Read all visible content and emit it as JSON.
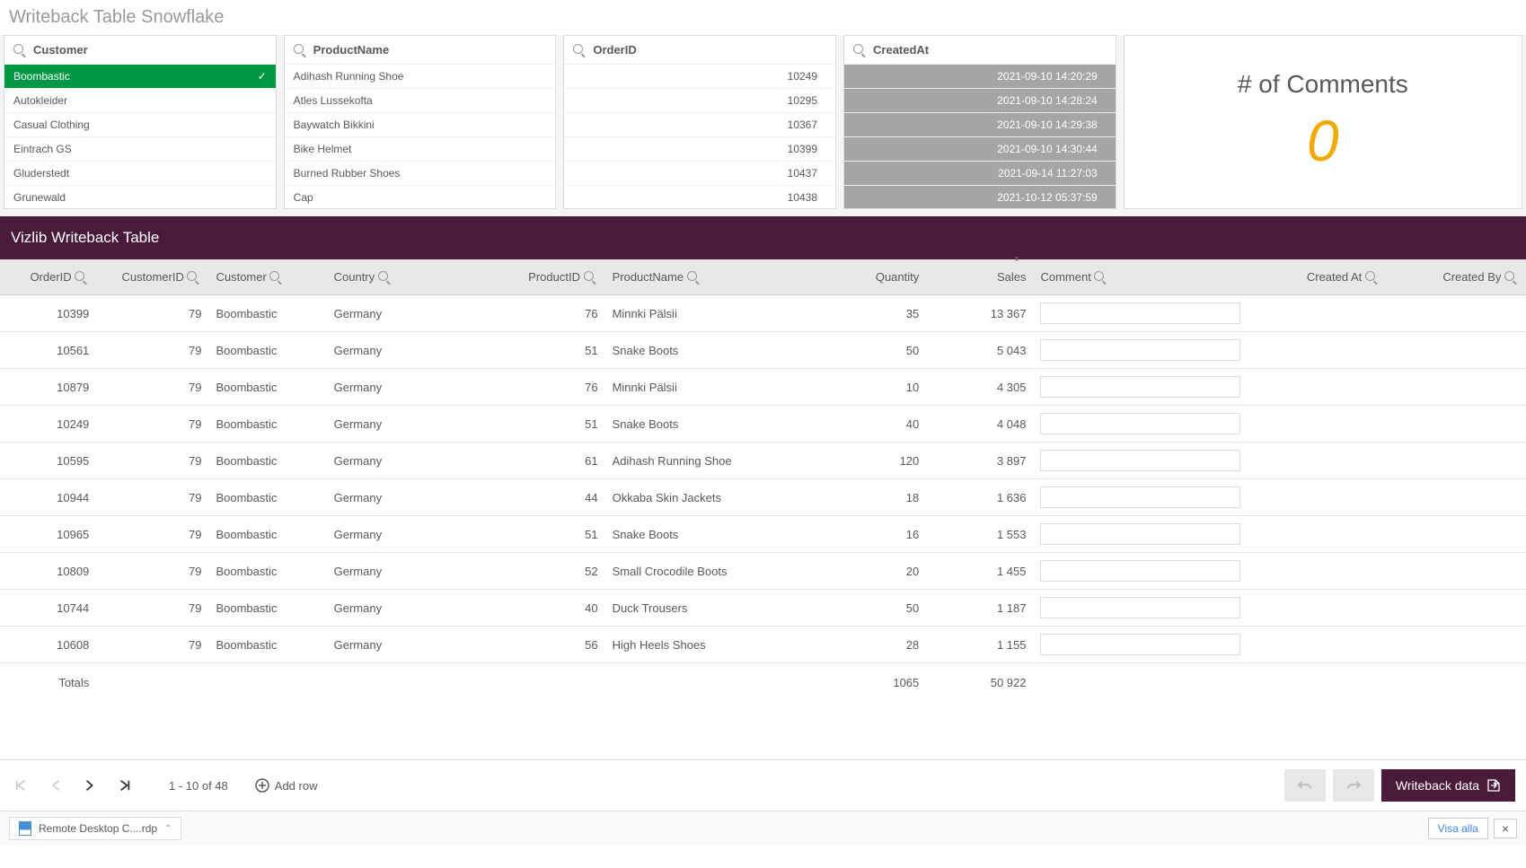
{
  "page_title": "Writeback Table Snowflake",
  "filters": {
    "customer": {
      "label": "Customer",
      "items": [
        "Boombastic",
        "Autokleider",
        "Casual Clothing",
        "Eintrach GS",
        "Gluderstedt",
        "Grunewald"
      ],
      "selected_index": 0
    },
    "product": {
      "label": "ProductName",
      "items": [
        "Adihash Running Shoe",
        "Atles Lussekofta",
        "Baywatch Bikkini",
        "Bike Helmet",
        "Burned Rubber Shoes",
        "Cap"
      ]
    },
    "order": {
      "label": "OrderID",
      "items": [
        "10249",
        "10295",
        "10367",
        "10399",
        "10437",
        "10438"
      ]
    },
    "created": {
      "label": "CreatedAt",
      "items": [
        "2021-09-10 14:20:29",
        "2021-09-10 14:28:24",
        "2021-09-10 14:29:38",
        "2021-09-10 14:30:44",
        "2021-09-14 11:27:03",
        "2021-10-12 05:37:59"
      ]
    }
  },
  "kpi": {
    "title": "# of Comments",
    "value": "0"
  },
  "table_title": "Vizlib Writeback Table",
  "columns": [
    "OrderID",
    "CustomerID",
    "Customer",
    "Country",
    "ProductID",
    "ProductName",
    "Quantity",
    "Sales",
    "Comment",
    "Created At",
    "Created By"
  ],
  "rows": [
    {
      "orderid": "10399",
      "customerid": "79",
      "customer": "Boombastic",
      "country": "Germany",
      "productid": "76",
      "productname": "Minnki Pälsii",
      "quantity": "35",
      "sales": "13 367"
    },
    {
      "orderid": "10561",
      "customerid": "79",
      "customer": "Boombastic",
      "country": "Germany",
      "productid": "51",
      "productname": "Snake Boots",
      "quantity": "50",
      "sales": "5 043"
    },
    {
      "orderid": "10879",
      "customerid": "79",
      "customer": "Boombastic",
      "country": "Germany",
      "productid": "76",
      "productname": "Minnki Pälsii",
      "quantity": "10",
      "sales": "4 305"
    },
    {
      "orderid": "10249",
      "customerid": "79",
      "customer": "Boombastic",
      "country": "Germany",
      "productid": "51",
      "productname": "Snake Boots",
      "quantity": "40",
      "sales": "4 048"
    },
    {
      "orderid": "10595",
      "customerid": "79",
      "customer": "Boombastic",
      "country": "Germany",
      "productid": "61",
      "productname": "Adihash Running Shoe",
      "quantity": "120",
      "sales": "3 897"
    },
    {
      "orderid": "10944",
      "customerid": "79",
      "customer": "Boombastic",
      "country": "Germany",
      "productid": "44",
      "productname": "Okkaba Skin Jackets",
      "quantity": "18",
      "sales": "1 636"
    },
    {
      "orderid": "10965",
      "customerid": "79",
      "customer": "Boombastic",
      "country": "Germany",
      "productid": "51",
      "productname": "Snake Boots",
      "quantity": "16",
      "sales": "1 553"
    },
    {
      "orderid": "10809",
      "customerid": "79",
      "customer": "Boombastic",
      "country": "Germany",
      "productid": "52",
      "productname": "Small Crocodile Boots",
      "quantity": "20",
      "sales": "1 455"
    },
    {
      "orderid": "10744",
      "customerid": "79",
      "customer": "Boombastic",
      "country": "Germany",
      "productid": "40",
      "productname": "Duck Trousers",
      "quantity": "50",
      "sales": "1 187"
    },
    {
      "orderid": "10608",
      "customerid": "79",
      "customer": "Boombastic",
      "country": "Germany",
      "productid": "56",
      "productname": "High Heels Shoes",
      "quantity": "28",
      "sales": "1 155"
    }
  ],
  "totals": {
    "label": "Totals",
    "quantity": "1065",
    "sales": "50 922"
  },
  "pager": {
    "info": "1 - 10 of 48"
  },
  "buttons": {
    "add_row": "Add row",
    "writeback": "Writeback data",
    "visa": "Visa alla",
    "close": "×"
  },
  "download": {
    "filename": "Remote Desktop C....rdp"
  }
}
